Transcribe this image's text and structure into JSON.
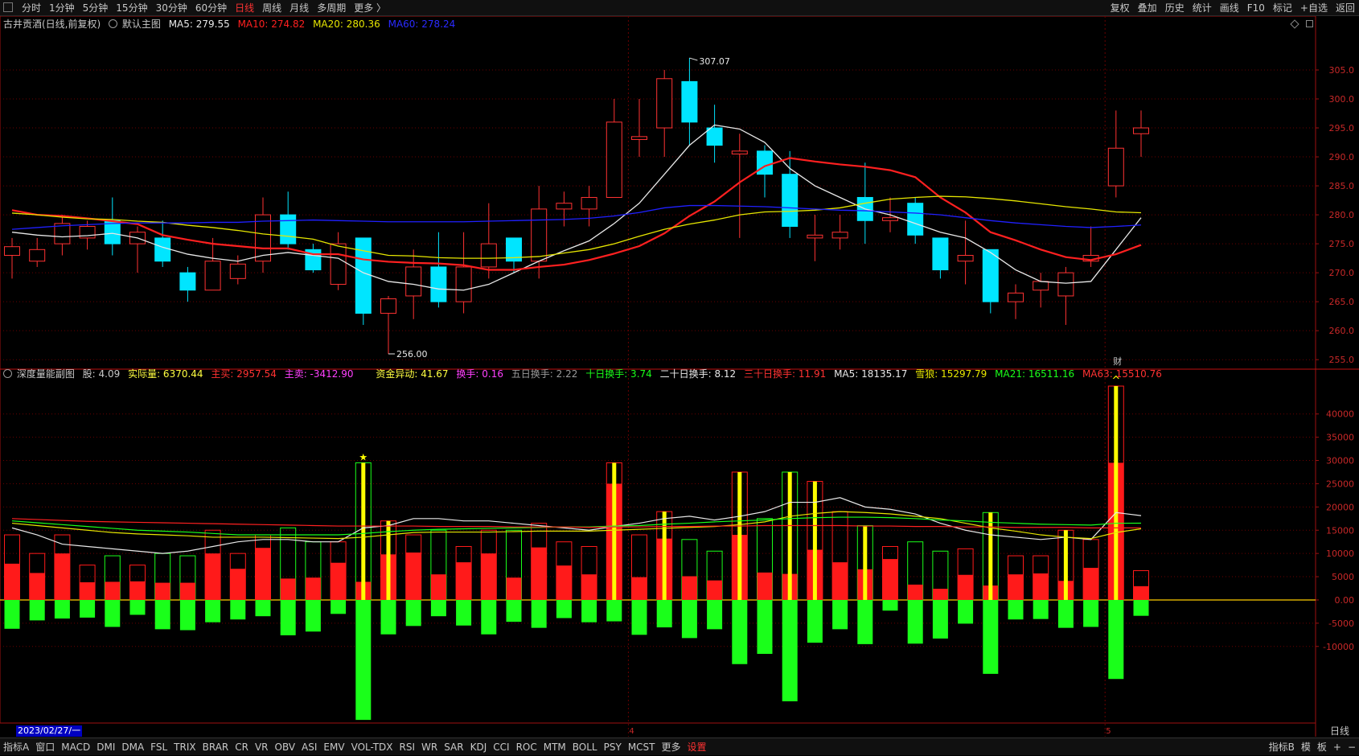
{
  "top_tabs": [
    {
      "label": "分时"
    },
    {
      "label": "1分钟"
    },
    {
      "label": "5分钟"
    },
    {
      "label": "15分钟"
    },
    {
      "label": "30分钟"
    },
    {
      "label": "60分钟"
    },
    {
      "label": "日线",
      "active": true
    },
    {
      "label": "周线"
    },
    {
      "label": "月线"
    },
    {
      "label": "多周期"
    },
    {
      "label": "更多 〉"
    }
  ],
  "right_buttons": [
    "复权",
    "叠加",
    "历史",
    "统计",
    "画线",
    "F10",
    "标记",
    "+自选",
    "返回"
  ],
  "main_info": {
    "title": "古井贡酒(日线,前复权)",
    "mode": "默认主图",
    "ma5": "MA5: 279.55",
    "ma10": "MA10: 274.82",
    "ma20": "MA20: 280.36",
    "ma60": "MA60: 278.24"
  },
  "sub_info": {
    "name": "深度量能副图",
    "gu": "股: 4.09",
    "actual": "实际量: 6370.44",
    "zhumai": "主买: 2957.54",
    "zhumai2": "主卖: -3412.90",
    "zijin": "资金异动: 41.67",
    "huanshou": "换手: 0.16",
    "h5": "五日换手: 2.22",
    "h10": "十日换手: 3.74",
    "h20": "二十日换手: 8.12",
    "h30": "三十日换手: 11.91",
    "ma5": "MA5: 18135.17",
    "xuelang": "雪狼: 15297.79",
    "ma21": "MA21: 16511.16",
    "ma63": "MA63: 15510.76"
  },
  "bottom_indicators": [
    "指标A",
    "窗口",
    "MACD",
    "DMI",
    "DMA",
    "FSL",
    "TRIX",
    "BRAR",
    "CR",
    "VR",
    "OBV",
    "ASI",
    "EMV",
    "VOL-TDX",
    "RSI",
    "WR",
    "SAR",
    "KDJ",
    "CCI",
    "ROC",
    "MTM",
    "BOLL",
    "PSY",
    "MCST",
    "更多",
    "设置"
  ],
  "bottom_right": [
    "指标B",
    "模",
    "板",
    "+",
    "−"
  ],
  "date_label": "2023/02/27/一",
  "period_label": "日线",
  "colors": {
    "up": "#ff3232",
    "down": "#00e5ff",
    "ma5": "#e8e8e8",
    "ma10": "#ff2020",
    "ma20": "#e6e600",
    "ma60": "#2020ff",
    "vol_up": "#ff1a1a",
    "vol_down": "#1aff1a",
    "yellow": "#ffff00"
  },
  "chart_data": [
    {
      "type": "candlestick",
      "title": "古井贡酒(日线,前复权)",
      "y_ticks": [
        305,
        300,
        295,
        290,
        285,
        280,
        275,
        270,
        265,
        260,
        255
      ],
      "ylim": [
        253.5,
        311.8
      ],
      "max_label": "307.07",
      "min_label": "256.00",
      "month_markers": [
        {
          "index": 25,
          "label": "4"
        },
        {
          "index": 44,
          "label": "5"
        }
      ],
      "fin_marker": {
        "index": 44,
        "label": "财"
      },
      "candles": [
        {
          "o": 273,
          "c": 274.5,
          "h": 276,
          "l": 269
        },
        {
          "o": 272,
          "c": 274,
          "h": 276,
          "l": 271
        },
        {
          "o": 275,
          "c": 278.5,
          "h": 280,
          "l": 273
        },
        {
          "o": 276,
          "c": 278,
          "h": 279,
          "l": 274
        },
        {
          "o": 279,
          "c": 275,
          "h": 283,
          "l": 273
        },
        {
          "o": 275,
          "c": 277,
          "h": 278,
          "l": 270
        },
        {
          "o": 276,
          "c": 272,
          "h": 279,
          "l": 271
        },
        {
          "o": 270,
          "c": 267,
          "h": 271,
          "l": 265
        },
        {
          "o": 267,
          "c": 272,
          "h": 276,
          "l": 267
        },
        {
          "o": 269,
          "c": 271.5,
          "h": 273,
          "l": 268
        },
        {
          "o": 272,
          "c": 280,
          "h": 283,
          "l": 270
        },
        {
          "o": 280,
          "c": 275,
          "h": 284,
          "l": 274
        },
        {
          "o": 274,
          "c": 270.5,
          "h": 275,
          "l": 270
        },
        {
          "o": 268,
          "c": 275,
          "h": 277,
          "l": 267
        },
        {
          "o": 276,
          "c": 263,
          "h": 276,
          "l": 261
        },
        {
          "o": 263,
          "c": 265.5,
          "h": 266,
          "l": 256
        },
        {
          "o": 266,
          "c": 271,
          "h": 274,
          "l": 262
        },
        {
          "o": 271,
          "c": 265,
          "h": 277,
          "l": 264
        },
        {
          "o": 265,
          "c": 271,
          "h": 277,
          "l": 263
        },
        {
          "o": 271,
          "c": 275,
          "h": 282,
          "l": 269
        },
        {
          "o": 276,
          "c": 272,
          "h": 276,
          "l": 270
        },
        {
          "o": 272,
          "c": 281,
          "h": 285,
          "l": 269
        },
        {
          "o": 281,
          "c": 282,
          "h": 284,
          "l": 278
        },
        {
          "o": 281,
          "c": 283,
          "h": 285,
          "l": 278
        },
        {
          "o": 283,
          "c": 296,
          "h": 300,
          "l": 283
        },
        {
          "o": 293,
          "c": 293.5,
          "h": 300,
          "l": 290
        },
        {
          "o": 295,
          "c": 303.5,
          "h": 305,
          "l": 290
        },
        {
          "o": 303,
          "c": 296,
          "h": 307.07,
          "l": 292
        },
        {
          "o": 295,
          "c": 292,
          "h": 299,
          "l": 289
        },
        {
          "o": 290.5,
          "c": 291,
          "h": 294,
          "l": 276
        },
        {
          "o": 291,
          "c": 287,
          "h": 292,
          "l": 283
        },
        {
          "o": 287,
          "c": 278,
          "h": 291,
          "l": 276
        },
        {
          "o": 276,
          "c": 276.5,
          "h": 280,
          "l": 272
        },
        {
          "o": 276,
          "c": 277,
          "h": 280,
          "l": 274
        },
        {
          "o": 283,
          "c": 279,
          "h": 289,
          "l": 275
        },
        {
          "o": 279,
          "c": 279.5,
          "h": 283,
          "l": 277
        },
        {
          "o": 282,
          "c": 276.5,
          "h": 283,
          "l": 275
        },
        {
          "o": 276,
          "c": 270.5,
          "h": 276,
          "l": 269
        },
        {
          "o": 272,
          "c": 273,
          "h": 279,
          "l": 268
        },
        {
          "o": 274,
          "c": 265,
          "h": 274,
          "l": 263
        },
        {
          "o": 265,
          "c": 266.5,
          "h": 268,
          "l": 262
        },
        {
          "o": 267,
          "c": 268.5,
          "h": 270,
          "l": 264
        },
        {
          "o": 266,
          "c": 270,
          "h": 271,
          "l": 261
        },
        {
          "o": 272,
          "c": 273,
          "h": 278,
          "l": 271
        },
        {
          "o": 285,
          "c": 291.5,
          "h": 298,
          "l": 283
        },
        {
          "o": 294,
          "c": 295,
          "h": 298,
          "l": 290
        }
      ],
      "ma_series": [
        {
          "name": "MA5",
          "key": "ma5",
          "values": [
            277,
            276.5,
            276.2,
            276.4,
            276.8,
            276,
            274.4,
            273.2,
            272.5,
            272,
            273,
            273.5,
            273,
            272.5,
            270,
            268.5,
            268,
            267.2,
            267,
            268,
            270,
            272,
            273.8,
            275.5,
            278.5,
            282,
            287,
            292,
            295.5,
            294.8,
            292.5,
            288,
            285,
            283,
            281,
            280,
            278.5,
            277,
            276,
            273.5,
            270.5,
            268.5,
            268.2,
            268.5,
            274,
            279.5
          ]
        },
        {
          "name": "MA10",
          "key": "ma10",
          "values": [
            280.8,
            280,
            279.8,
            279.4,
            278.9,
            278.4,
            276.5,
            275.7,
            275,
            274.6,
            274.2,
            274.2,
            273.2,
            273.2,
            272.3,
            271.9,
            271.7,
            271.6,
            271.3,
            270.5,
            270.5,
            271,
            271.4,
            272.2,
            273.3,
            274.6,
            276.8,
            279.8,
            282.3,
            285.6,
            288.4,
            289.8,
            289.2,
            288.7,
            288.3,
            287.7,
            286.5,
            283,
            280.4,
            277,
            275.6,
            274,
            272.7,
            272.2,
            273.2,
            274.8
          ]
        },
        {
          "name": "MA20",
          "key": "ma20",
          "values": [
            280.3,
            280,
            279.6,
            279.3,
            279.2,
            278.9,
            278.7,
            278.2,
            277.8,
            277.3,
            276.7,
            276.3,
            275.8,
            274.6,
            273.8,
            273,
            272.9,
            272.6,
            272.5,
            272.5,
            272.6,
            272.8,
            273.4,
            274,
            275,
            276.3,
            277.5,
            278.4,
            279.1,
            280,
            280.5,
            280.6,
            280.8,
            281.2,
            282,
            282.7,
            283,
            283.2,
            283.1,
            282.8,
            282.4,
            281.9,
            281.4,
            281,
            280.5,
            280.36
          ]
        },
        {
          "name": "MA60",
          "key": "ma60",
          "values": [
            277.5,
            277.8,
            278.1,
            278.3,
            278.5,
            278.6,
            278.6,
            278.6,
            278.7,
            278.7,
            278.9,
            279,
            279.1,
            279,
            278.9,
            278.8,
            278.8,
            278.8,
            278.8,
            278.9,
            279,
            279.1,
            279.2,
            279.4,
            279.8,
            280.4,
            281.2,
            281.6,
            281.6,
            281.5,
            281.4,
            281.2,
            281,
            280.8,
            280.7,
            280.5,
            280.3,
            280,
            279.5,
            279,
            278.6,
            278.3,
            278,
            277.8,
            278,
            278.24
          ]
        }
      ]
    },
    {
      "type": "bar",
      "title": "深度量能副图",
      "y_ticks": [
        40000,
        35000,
        30000,
        25000,
        20000,
        15000,
        10000,
        5000,
        0,
        -5000,
        -10000
      ],
      "ylim": [
        -26300,
        46700
      ],
      "star_index": 14,
      "caret_index": 44,
      "volume": [
        14000,
        10000,
        14000,
        7500,
        9500,
        7500,
        10000,
        9500,
        15000,
        10000,
        14000,
        15500,
        12500,
        12500,
        29500,
        17000,
        14000,
        15000,
        11500,
        15000,
        15000,
        16500,
        12500,
        11500,
        29500,
        14000,
        19000,
        13000,
        10500,
        27500,
        17500,
        27500,
        25500,
        19000,
        16000,
        11500,
        12500,
        10500,
        11000,
        18800,
        9500,
        9500,
        15000,
        13000,
        46000,
        6300
      ],
      "buy": [
        7800,
        5800,
        10000,
        3800,
        3900,
        4000,
        3700,
        3700,
        10000,
        6700,
        11200,
        4600,
        4800,
        8000,
        3900,
        9800,
        10200,
        5500,
        8100,
        10000,
        4800,
        11300,
        7400,
        5500,
        25000,
        4900,
        13200,
        5100,
        4200,
        14000,
        5900,
        5600,
        10800,
        8100,
        6600,
        8800,
        3300,
        2400,
        5400,
        3100,
        5500,
        5700,
        4100,
        6900,
        29500,
        2957.54
      ],
      "sell": [
        -6200,
        -4400,
        -4000,
        -3800,
        -5800,
        -3200,
        -6300,
        -6500,
        -4800,
        -4200,
        -3500,
        -7600,
        -6800,
        -3000,
        -25800,
        -7400,
        -5600,
        -3500,
        -5500,
        -7400,
        -4700,
        -6000,
        -3900,
        -4800,
        -4600,
        -7500,
        -5900,
        -8200,
        -6300,
        -13800,
        -11600,
        -21800,
        -9200,
        -6300,
        -9500,
        -2300,
        -9400,
        -8300,
        -5100,
        -15900,
        -4200,
        -4100,
        -6000,
        -5800,
        -17000,
        -3412.9
      ],
      "yellow_idx": [
        14,
        15,
        24,
        26,
        29,
        31,
        32,
        34,
        39,
        42,
        44
      ],
      "ma_series": [
        {
          "name": "MA5",
          "key": "ma5",
          "values": [
            15500,
            14000,
            12000,
            11500,
            11000,
            10500,
            10000,
            10500,
            11500,
            12500,
            13000,
            13000,
            12500,
            12500,
            15500,
            16000,
            17500,
            17500,
            17000,
            17000,
            16500,
            16000,
            15500,
            15000,
            15800,
            16500,
            17500,
            18000,
            17200,
            18000,
            19000,
            21000,
            21000,
            22000,
            20000,
            19500,
            18500,
            16500,
            15000,
            14000,
            13500,
            13000,
            13500,
            13000,
            18800,
            18135.17
          ]
        },
        {
          "name": "雪狼",
          "key": "ma20",
          "values": [
            16500,
            16000,
            15500,
            15000,
            14500,
            14200,
            14000,
            13800,
            13500,
            13500,
            13500,
            13400,
            13300,
            13200,
            13500,
            14000,
            14500,
            14600,
            14600,
            14600,
            14700,
            14800,
            14800,
            14800,
            15000,
            15200,
            15400,
            15600,
            15800,
            16200,
            16800,
            18000,
            18600,
            19000,
            18800,
            18500,
            18000,
            17500,
            16500,
            15500,
            14800,
            14000,
            13500,
            13200,
            14500,
            15297.79
          ]
        },
        {
          "name": "MA21",
          "key": "ma21",
          "values": [
            17000,
            16600,
            16200,
            15800,
            15400,
            15000,
            14800,
            14600,
            14300,
            14000,
            14000,
            14000,
            14000,
            14000,
            14300,
            14700,
            15000,
            15200,
            15300,
            15400,
            15500,
            15600,
            15700,
            15700,
            15900,
            16000,
            16300,
            16500,
            16800,
            17000,
            17200,
            17500,
            17700,
            17800,
            17800,
            17700,
            17500,
            17200,
            17000,
            16700,
            16500,
            16300,
            16200,
            16100,
            16500,
            16511.16
          ]
        },
        {
          "name": "MA63",
          "key": "ma63",
          "values": [
            17500,
            17300,
            17100,
            16900,
            16800,
            16700,
            16600,
            16500,
            16400,
            16300,
            16200,
            16100,
            16000,
            15900,
            15900,
            15900,
            15900,
            15800,
            15800,
            15800,
            15700,
            15700,
            15700,
            15600,
            15700,
            15700,
            15800,
            15800,
            15900,
            15900,
            16000,
            16000,
            16000,
            16000,
            15900,
            15900,
            15800,
            15800,
            15700,
            15700,
            15600,
            15600,
            15600,
            15500,
            15500,
            15510.76
          ]
        }
      ]
    }
  ]
}
